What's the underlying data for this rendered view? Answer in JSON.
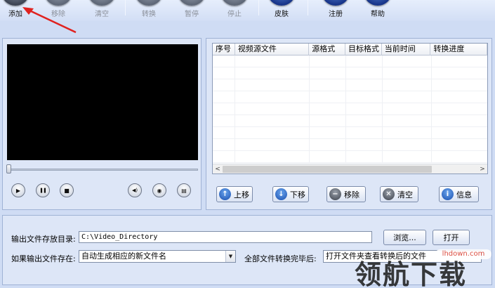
{
  "toolbar": {
    "buttons": [
      {
        "label": "添加",
        "icon": "add-icon",
        "enabled": true
      },
      {
        "label": "移除",
        "icon": "remove-icon",
        "enabled": false
      },
      {
        "label": "清空",
        "icon": "clear-icon",
        "enabled": false
      },
      {
        "label": "转换",
        "icon": "convert-icon",
        "enabled": false
      },
      {
        "label": "暂停",
        "icon": "pause-icon",
        "enabled": false
      },
      {
        "label": "停止",
        "icon": "stop-icon",
        "enabled": false
      },
      {
        "label": "皮肤",
        "icon": "skin-icon",
        "enabled": true
      },
      {
        "label": "注册",
        "icon": "register-icon",
        "enabled": true
      },
      {
        "label": "帮助",
        "icon": "help-icon",
        "enabled": true
      }
    ]
  },
  "player": {
    "controls": [
      {
        "name": "play-icon",
        "glyph": "▶"
      },
      {
        "name": "pause-icon",
        "glyph": "❚❚"
      },
      {
        "name": "stop-icon",
        "glyph": "■"
      },
      {
        "name": "volume-icon",
        "glyph": "◀)"
      },
      {
        "name": "snapshot-icon",
        "glyph": "◉"
      },
      {
        "name": "folder-icon",
        "glyph": "▤"
      }
    ]
  },
  "file_list": {
    "columns": [
      "序号",
      "视频源文件",
      "源格式",
      "目标格式",
      "当前时间",
      "转换进度"
    ],
    "scroll_left": "<",
    "scroll_right": ">"
  },
  "actions": {
    "up": "上移",
    "down": "下移",
    "remove": "移除",
    "clear": "清空",
    "info": "信息"
  },
  "output": {
    "dir_label": "输出文件存放目录:",
    "dir_value": "C:\\Video_Directory",
    "browse": "浏览...",
    "open": "打开",
    "exists_label": "如果输出文件存在:",
    "exists_value": "自动生成相应的新文件名",
    "after_label": "全部文件转换完毕后:",
    "after_value": "打开文件夹查看转换后的文件"
  },
  "watermark": {
    "url": "lhdown.com",
    "text": "领航下载"
  },
  "colors": {
    "annotation_arrow": "#e0221f",
    "background": "#cfdcf4"
  }
}
